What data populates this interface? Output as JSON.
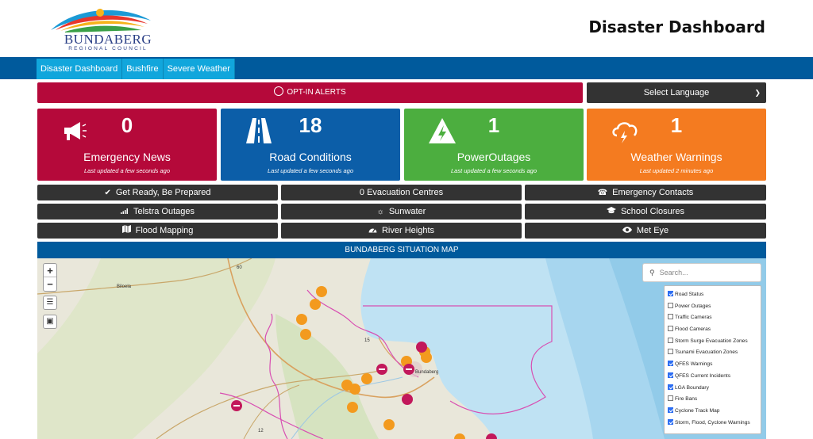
{
  "header": {
    "logo_word": "BUNDABERG",
    "logo_sub": "REGIONAL COUNCIL",
    "title": "Disaster Dashboard"
  },
  "nav": {
    "tabs": [
      {
        "label": "Disaster Dashboard"
      },
      {
        "label": "Bushfire"
      },
      {
        "label": "Severe Weather"
      }
    ]
  },
  "alerts": {
    "optin_label": "OPT-IN ALERTS",
    "language_label": "Select Language"
  },
  "cards": [
    {
      "count": "0",
      "label": "Emergency News",
      "updated": "Last updated a few seconds ago",
      "color": "#b5093a",
      "icon": "megaphone-icon"
    },
    {
      "count": "18",
      "label": "Road Conditions",
      "updated": "Last updated a few seconds ago",
      "color": "#0c5ea8",
      "icon": "road-icon"
    },
    {
      "count": "1",
      "label": "PowerOutages",
      "updated": "Last updated a few seconds ago",
      "color": "#4cae3f",
      "icon": "lightning-warning-icon"
    },
    {
      "count": "1",
      "label": "Weather Warnings",
      "updated": "Last updated 2 minutes ago",
      "color": "#f47b20",
      "icon": "storm-cloud-icon"
    }
  ],
  "buttons": [
    {
      "label": "Get Ready, Be Prepared",
      "icon": "check-circle-icon"
    },
    {
      "label": "0  Evacuation Centres",
      "icon": ""
    },
    {
      "label": "Emergency Contacts",
      "icon": "phone-icon"
    },
    {
      "label": "Telstra Outages",
      "icon": "signal-icon"
    },
    {
      "label": "Sunwater",
      "icon": "sun-icon"
    },
    {
      "label": "School Closures",
      "icon": "graduation-cap-icon"
    },
    {
      "label": "Flood Mapping",
      "icon": "map-icon"
    },
    {
      "label": "River Heights",
      "icon": "gauge-icon"
    },
    {
      "label": "Met Eye",
      "icon": "eye-icon"
    }
  ],
  "map": {
    "title": "BUNDABERG SITUATION MAP",
    "search_placeholder": "Search...",
    "place_labels": [
      "Biloela",
      "Bundaberg"
    ],
    "road_numbers": [
      "60",
      "15",
      "12"
    ],
    "layers": [
      {
        "label": "Road Status",
        "checked": true
      },
      {
        "label": "Power Outages",
        "checked": false
      },
      {
        "label": "Traffic Cameras",
        "checked": false
      },
      {
        "label": "Flood Cameras",
        "checked": false
      },
      {
        "label": "Storm Surge Evacuation Zones",
        "checked": false
      },
      {
        "label": "Tsunami Evacuation Zones",
        "checked": false
      },
      {
        "label": "QFES Warnings",
        "checked": true
      },
      {
        "label": "QFES Current Incidents",
        "checked": true
      },
      {
        "label": "LGA Boundary",
        "checked": true
      },
      {
        "label": "Fire Bans",
        "checked": false
      },
      {
        "label": "Cyclone Track Map",
        "checked": true
      },
      {
        "label": "Storm, Flood, Cyclone Warnings",
        "checked": true
      }
    ]
  }
}
